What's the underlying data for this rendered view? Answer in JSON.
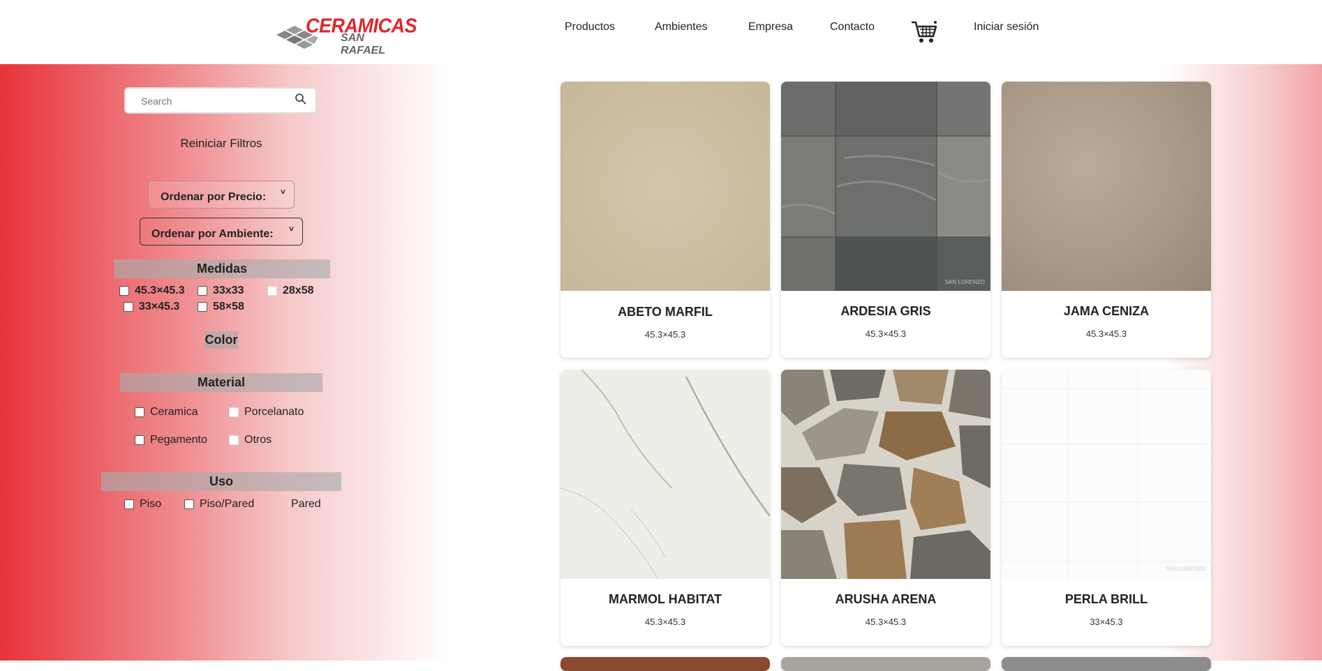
{
  "brand": {
    "line1": "CERAMICAS",
    "line2": "SAN RAFAEL"
  },
  "nav": {
    "productos": "Productos",
    "ambientes": "Ambientes",
    "empresa": "Empresa",
    "contacto": "Contacto",
    "login": "Iniciar sesión"
  },
  "filters": {
    "search_placeholder": "Search",
    "reset": "Reiniciar Filtros",
    "sort_price": "Ordenar por Precio:",
    "sort_env": "Ordenar por Ambiente:",
    "medidas_title": "Medidas",
    "medidas": [
      "45.3×45.3",
      "33x33",
      "28x58",
      "33×45.3",
      "58×58"
    ],
    "color_title": "Color",
    "material_title": "Material",
    "materials": [
      "Ceramica",
      "Porcelanato",
      "Pegamento",
      "Otros"
    ],
    "uso_title": "Uso",
    "usos": [
      "Piso",
      "Piso/Pared",
      "Pared"
    ]
  },
  "products": [
    {
      "name": "ABETO MARFIL",
      "size": "45.3×45.3"
    },
    {
      "name": "ARDESIA GRIS",
      "size": "45.3×45.3"
    },
    {
      "name": "JAMA CENIZA",
      "size": "45.3×45.3"
    },
    {
      "name": "MARMOL HABITAT",
      "size": "45.3×45.3"
    },
    {
      "name": "ARUSHA ARENA",
      "size": "45.3×45.3"
    },
    {
      "name": "PERLA BRILL",
      "size": "33×45.3"
    }
  ],
  "watermark": "SAN LORENZO",
  "colors": {
    "accent": "#e0262d",
    "gradient_red": "#e8333a"
  }
}
